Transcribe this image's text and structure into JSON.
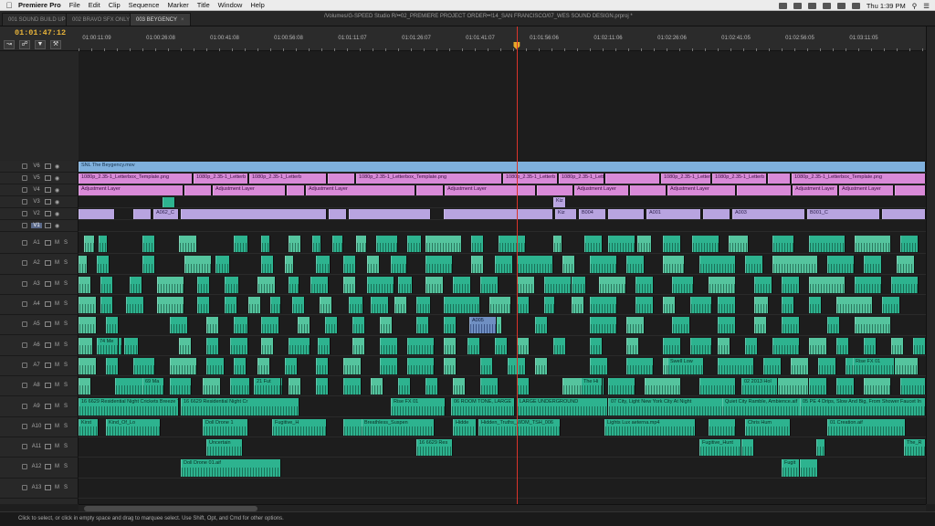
{
  "menubar": {
    "app_name": "Premiere Pro",
    "items": [
      "File",
      "Edit",
      "Clip",
      "Sequence",
      "Marker",
      "Title",
      "Window",
      "Help"
    ],
    "clock": "Thu 1:39 PM"
  },
  "tabs": [
    {
      "label": "001 SOUND BUILD UP",
      "active": false
    },
    {
      "label": "002 BRAVO SFX ONLY",
      "active": false
    },
    {
      "label": "003 BEYGENCY",
      "active": true
    }
  ],
  "project_path": "/Volumes/G-SPEED Studio R/••02_PREMIERE PROJECT ORDER••!14_SAN FRANCISCO/07_WES SOUND DESIGN.prproj *",
  "timeline": {
    "timecode": "01:01:47:12",
    "ruler_labels": [
      "01:00:11:09",
      "01:00:26:08",
      "01:00:41:08",
      "01:00:56:08",
      "01:01:11:07",
      "01:01:26:07",
      "01:01:41:07",
      "01:01:56:06",
      "01:02:11:06",
      "01:02:26:06",
      "01:02:41:05",
      "01:02:56:05",
      "01:03:11:05"
    ],
    "playhead_fraction": 0.517
  },
  "tracks": {
    "video": [
      "V6",
      "V5",
      "V4",
      "V3",
      "V2",
      "V1"
    ],
    "audio": [
      "A1",
      "A2",
      "A3",
      "A4",
      "A5",
      "A6",
      "A7",
      "A8",
      "A9",
      "A10",
      "A11",
      "A12",
      "A13"
    ],
    "selected": "V1",
    "mute_label": "M",
    "solo_label": "S"
  },
  "clip_labels": {
    "v6": "SNL The Beygency.mov",
    "letterbox": "1080p_2.35-1_Letterbox_Template.png",
    "letterbox_short": "1080p_2.35-1_Letterb",
    "adjust": "Adjustment Layer",
    "a062": "A062_C",
    "kiz": "Kiz",
    "b004": "B004",
    "a001": "A001",
    "a003": "A003",
    "b001": "B001_C",
    "a9_1": "16 6629 Residential Night Crickets Breeze Thr",
    "a9_2": "16 6629 Residential Night Cr",
    "a9_3": "Rise FX 01",
    "a9_4": "06 ROOM TONE, LARGE",
    "a9_5": "LARGE UNDERGROUND",
    "a9_6": "07 City, Light New York City At Night",
    "a9_7": "Quiet City Ramble, Ambience.aif",
    "a9_8": "05 PE 4 Drips, Slow And Big, From Shower Faucet In",
    "a10_1": "Kirst",
    "a10_2": "Kind_Of_Lo",
    "a10_3": "Doll Drone 1",
    "a10_4": "Fugitive_H",
    "a10_5": "Breathless_Suspen",
    "a10_6": "Hidde",
    "a10_7": "Hidden_Truths_WDM_TSH_006",
    "a10_8": "Lights Lux aeterna.mp4",
    "a10_9": "Chris Hum",
    "a10_10": "01 Creation.aif",
    "a11_1": "Uncertain",
    "a11_2": "16 6629 Res",
    "a11_3": "Fugitive_Hunt",
    "a11_4": "The_R",
    "a12_1": "Doll Drone 01.aif",
    "a12_2": "Fugit",
    "a8_1": "69 Ma",
    "a8_2": "21 Fut",
    "a8_3": "The Hi",
    "a8_4": "02 2013 Hol",
    "a7_1": "Swell Low",
    "a7_2": "Rise FX 01",
    "a6_1": "74 Me",
    "a5_1": "A005"
  },
  "status_text": "Click to select, or click in empty space and drag to marquee select. Use Shift, Opt, and Cmd for other options."
}
